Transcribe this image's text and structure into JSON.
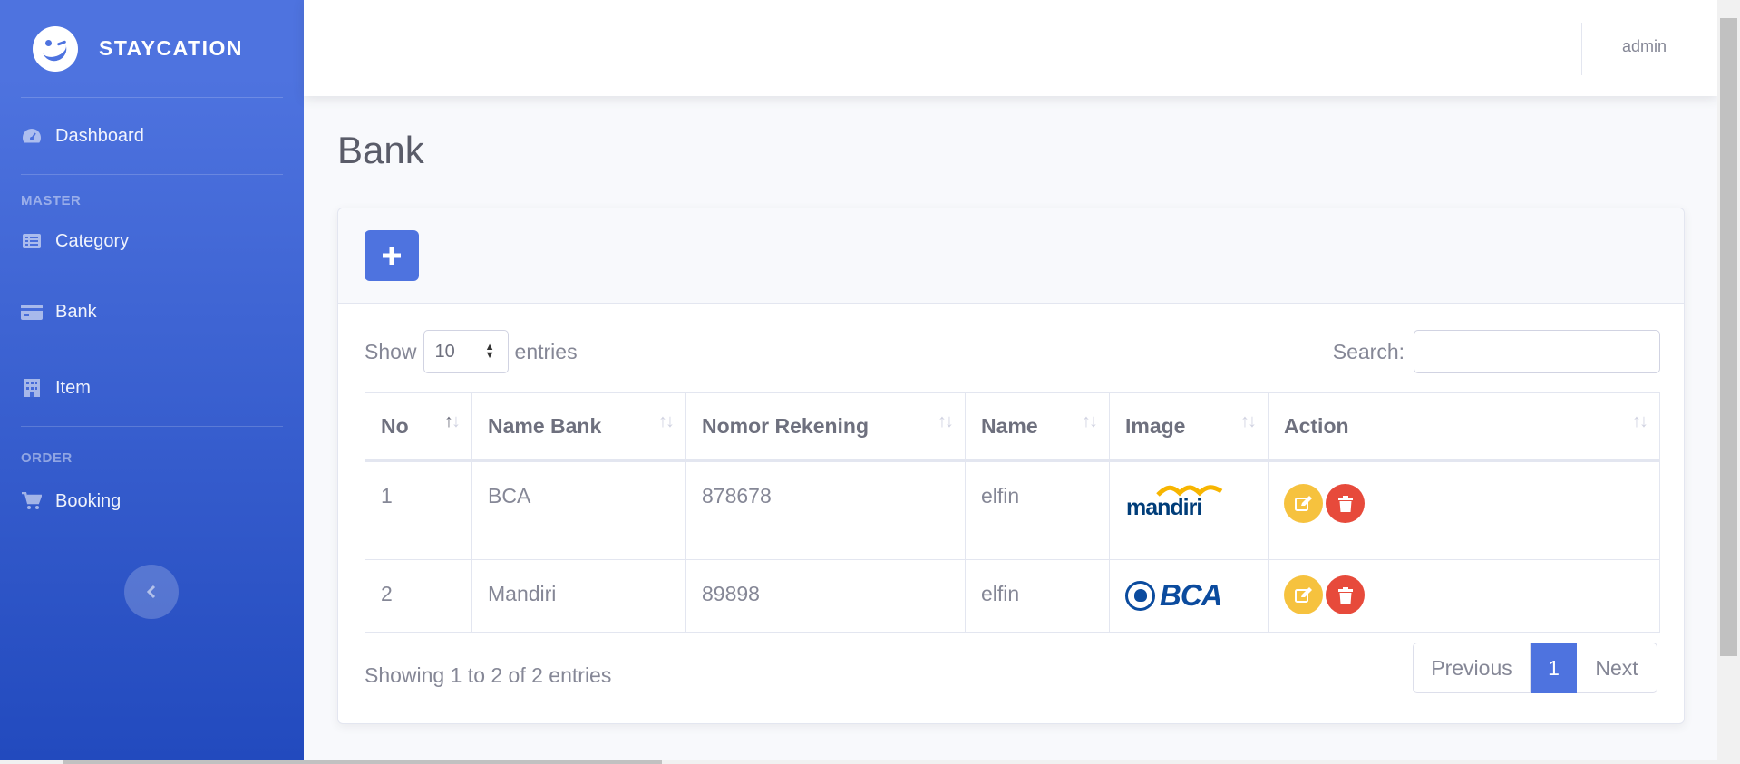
{
  "brand": {
    "name": "STAYCATION"
  },
  "sidebar": {
    "dashboard": "Dashboard",
    "heading_master": "MASTER",
    "items_master": [
      "Category",
      "Bank",
      "Item"
    ],
    "heading_order": "ORDER",
    "booking": "Booking",
    "icons": [
      "tachometer-icon",
      "list-alt-icon",
      "credit-card-icon",
      "building-icon",
      "shopping-cart-icon"
    ]
  },
  "topbar": {
    "user": "admin"
  },
  "page": {
    "title": "Bank"
  },
  "table_controls": {
    "show_label": "Show",
    "entries_value": "10",
    "entries_label": "entries",
    "search_label": "Search:",
    "search_value": ""
  },
  "table": {
    "headers": [
      "No",
      "Name Bank",
      "Nomor Rekening",
      "Name",
      "Image",
      "Action"
    ],
    "rows": [
      {
        "no": "1",
        "name_bank": "BCA",
        "nomor_rekening": "878678",
        "name": "elfin",
        "image": "mandiri"
      },
      {
        "no": "2",
        "name_bank": "Mandiri",
        "nomor_rekening": "89898",
        "name": "elfin",
        "image": "BCA"
      }
    ]
  },
  "footer": {
    "info": "Showing 1 to 2 of 2 entries",
    "previous": "Previous",
    "current_page": "1",
    "next": "Next"
  },
  "colors": {
    "primary": "#4e73df",
    "warning": "#f6c23e",
    "danger": "#e74a3b"
  }
}
